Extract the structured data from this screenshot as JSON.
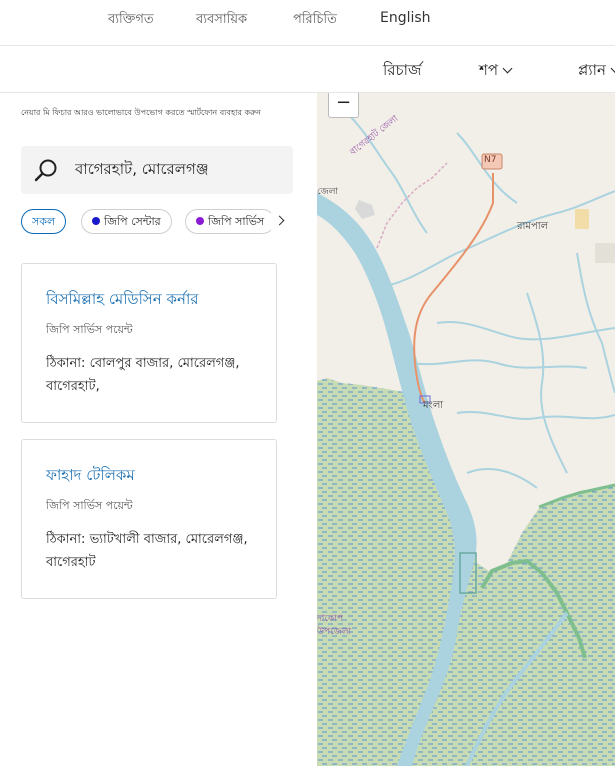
{
  "topbar": {
    "items": [
      "ব্যক্তিগত",
      "ব্যবসায়িক",
      "পরিচিতি",
      "English"
    ]
  },
  "navbar": {
    "items": [
      "রিচার্জ",
      "শপ",
      "প্ল্যান"
    ]
  },
  "hint": "নেয়ার মি ফিচার আরও ভালোভাবে উপভোগ করতে স্মার্টফোন ব্যবহার করুন",
  "search": {
    "value": "বাগেরহাট, মোরেলগঞ্জ"
  },
  "filters": [
    {
      "label": "সকল",
      "active": true
    },
    {
      "label": "জিপি সেন্টার",
      "color": "#1a1acc"
    },
    {
      "label": "জিপি সার্ভিস",
      "color": "#8a1ad6"
    }
  ],
  "results": [
    {
      "title": "বিসমিল্লাহ মেডিসিন কর্নার",
      "type": "জিপি সার্ভিস পয়েন্ট",
      "address": "ঠিকানা: বোলপুর বাজার, মোরেলগঞ্জ, বাগেরহাট,"
    },
    {
      "title": "ফাহাদ টেলিকম",
      "type": "জিপি সার্ভিস পয়েন্ট",
      "address": "ঠিকানা: ভ্যাটখালী বাজার, মোরেলগঞ্জ, বাগেরহাট"
    }
  ],
  "map": {
    "zoom_out": "−",
    "labels": {
      "district": "বাগেরহাট জেলা",
      "road": "N7",
      "rampal": "রামপাল",
      "mongla": "মংলা",
      "dacope": "দাকোপ উপজেলা",
      "jela": "জেলা"
    }
  }
}
